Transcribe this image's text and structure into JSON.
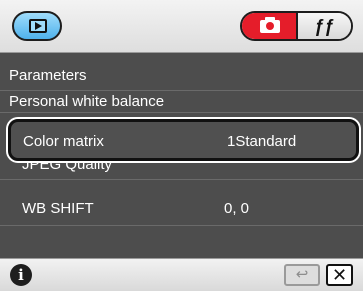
{
  "toolbar": {
    "play_icon": "playback-icon",
    "camera_icon": "camera-icon",
    "tools_icon": "tools-icon",
    "tools_glyph": "ƒƒ",
    "active_color": "#e51d2a",
    "play_color": "#4fb2ec"
  },
  "list": {
    "rows": [
      {
        "label": "Parameters",
        "value": ""
      },
      {
        "label": "Personal white balance",
        "value": ""
      },
      {
        "label": "Color matrix",
        "value": "1Standard",
        "selected": true
      },
      {
        "label": "JPEG Quality",
        "value": ""
      },
      {
        "label": "WB SHIFT",
        "value": "0, 0"
      }
    ],
    "background": "#4d4d4d"
  },
  "bottom": {
    "info_glyph": "i",
    "reset_glyph": "↩",
    "close_glyph": "✕"
  }
}
